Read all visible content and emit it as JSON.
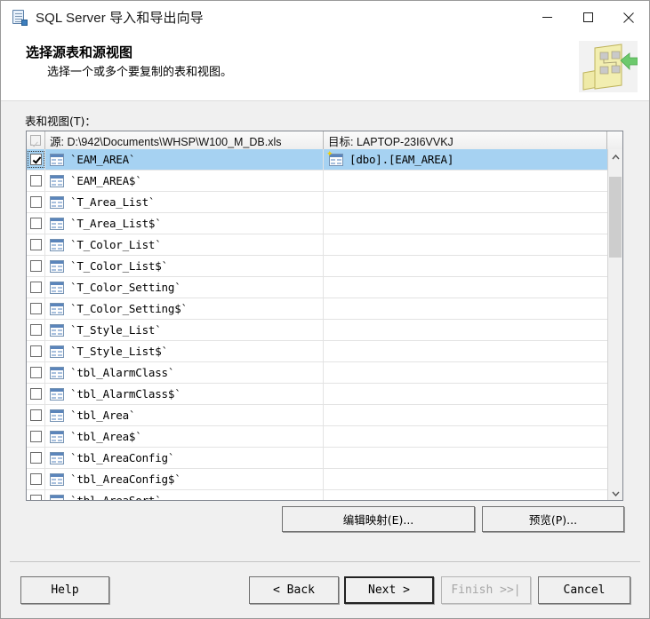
{
  "window": {
    "title": "SQL Server 导入和导出向导",
    "icon": "wizard-app-icon",
    "controls": {
      "minimize": "minimize-icon",
      "maximize": "maximize-icon",
      "close": "close-icon"
    }
  },
  "header": {
    "title": "选择源表和源视图",
    "subtitle": "选择一个或多个要复制的表和视图。",
    "art": "tables-and-views-graphic"
  },
  "main": {
    "list_label": "表和视图(T)：",
    "columns": {
      "select_all": "",
      "source": "源: D:\\942\\Documents\\WHSP\\W100_M_DB.xls",
      "destination": "目标: LAPTOP-23I6VVKJ"
    },
    "rows": [
      {
        "checked": true,
        "selected": true,
        "source": "`EAM_AREA`",
        "destination": "[dbo].[EAM_AREA]"
      },
      {
        "checked": false,
        "selected": false,
        "source": "`EAM_AREA$`",
        "destination": ""
      },
      {
        "checked": false,
        "selected": false,
        "source": "`T_Area_List`",
        "destination": ""
      },
      {
        "checked": false,
        "selected": false,
        "source": "`T_Area_List$`",
        "destination": ""
      },
      {
        "checked": false,
        "selected": false,
        "source": "`T_Color_List`",
        "destination": ""
      },
      {
        "checked": false,
        "selected": false,
        "source": "`T_Color_List$`",
        "destination": ""
      },
      {
        "checked": false,
        "selected": false,
        "source": "`T_Color_Setting`",
        "destination": ""
      },
      {
        "checked": false,
        "selected": false,
        "source": "`T_Color_Setting$`",
        "destination": ""
      },
      {
        "checked": false,
        "selected": false,
        "source": "`T_Style_List`",
        "destination": ""
      },
      {
        "checked": false,
        "selected": false,
        "source": "`T_Style_List$`",
        "destination": ""
      },
      {
        "checked": false,
        "selected": false,
        "source": "`tbl_AlarmClass`",
        "destination": ""
      },
      {
        "checked": false,
        "selected": false,
        "source": "`tbl_AlarmClass$`",
        "destination": ""
      },
      {
        "checked": false,
        "selected": false,
        "source": "`tbl_Area`",
        "destination": ""
      },
      {
        "checked": false,
        "selected": false,
        "source": "`tbl_Area$`",
        "destination": ""
      },
      {
        "checked": false,
        "selected": false,
        "source": "`tbl_AreaConfig`",
        "destination": ""
      },
      {
        "checked": false,
        "selected": false,
        "source": "`tbl_AreaConfig$`",
        "destination": ""
      },
      {
        "checked": false,
        "selected": false,
        "source": "`tbl_AreaSort`",
        "destination": ""
      }
    ],
    "scrollbar": {
      "up_arrow": "chevron-up-icon",
      "down_arrow": "chevron-down-icon",
      "thumb_top_pct": 4,
      "thumb_height_pct": 25
    },
    "edit_mappings_label": "编辑映射(E)...",
    "preview_label": "预览(P)..."
  },
  "footer": {
    "help": "Help",
    "back": "< Back",
    "next": "Next >",
    "finish": "Finish >>|",
    "cancel": "Cancel",
    "finish_enabled": false
  },
  "colors": {
    "selection": "#a6d2f2",
    "dialog_bg": "#f0f0f0",
    "list_bg": "#ffffff",
    "scroll_thumb": "#cdcdcd"
  }
}
